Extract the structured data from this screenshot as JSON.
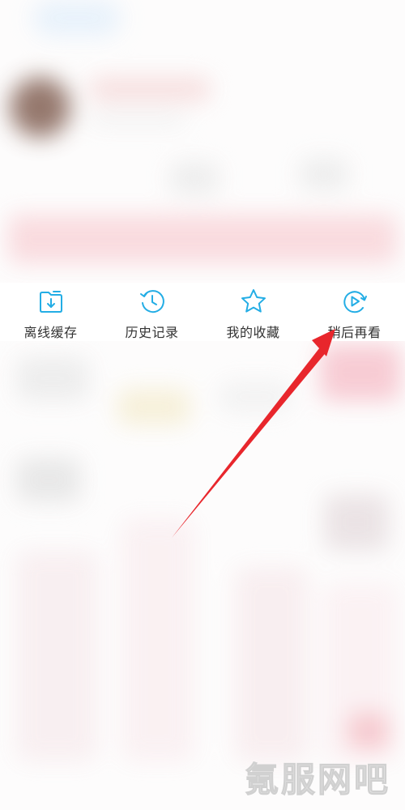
{
  "quick_actions": [
    {
      "label": "离线缓存",
      "icon": "download-folder-icon"
    },
    {
      "label": "历史记录",
      "icon": "history-clock-icon"
    },
    {
      "label": "我的收藏",
      "icon": "star-icon"
    },
    {
      "label": "稍后再看",
      "icon": "watch-later-icon"
    }
  ],
  "watermark": "氪服网吧",
  "colors": {
    "icon_accent": "#23ade5",
    "label_text": "#333333",
    "annotation_arrow": "#e8262c"
  }
}
